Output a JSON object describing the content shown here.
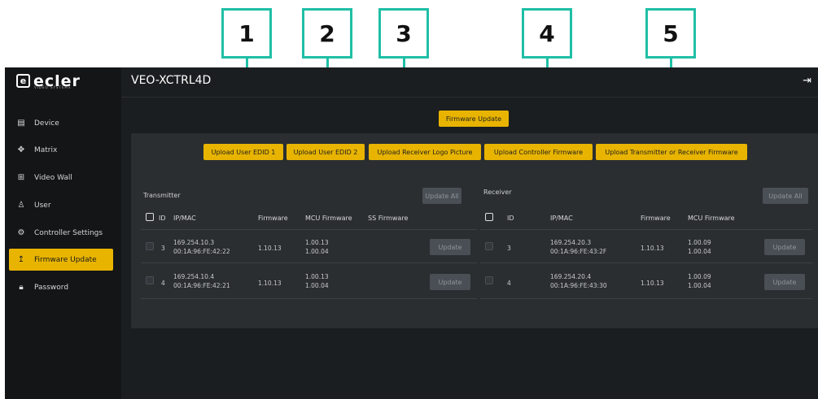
{
  "callouts": [
    "1",
    "2",
    "3",
    "4",
    "5"
  ],
  "brand": {
    "name": "ecler",
    "sub": "VIDEO SYSTEMS"
  },
  "sidebar": {
    "items": [
      {
        "label": "Device",
        "icon": "device-icon"
      },
      {
        "label": "Matrix",
        "icon": "matrix-icon"
      },
      {
        "label": "Video Wall",
        "icon": "grid-icon"
      },
      {
        "label": "User",
        "icon": "user-icon"
      },
      {
        "label": "Controller Settings",
        "icon": "gear-icon"
      },
      {
        "label": "Firmware Update",
        "icon": "upload-icon",
        "active": true
      },
      {
        "label": "Password",
        "icon": "lock-icon"
      }
    ]
  },
  "header": {
    "title": "VEO-XCTRL4D"
  },
  "main": {
    "firmware_update_button": "Firmware Update",
    "upload_buttons": [
      "Upload User EDID 1",
      "Upload User EDID 2",
      "Upload Receiver Logo Picture",
      "Upload Controller Firmware",
      "Upload Transmitter or Receiver Firmware"
    ],
    "transmitter": {
      "title": "Transmitter",
      "update_all": "Update All",
      "columns": [
        "ID",
        "IP/MAC",
        "Firmware",
        "MCU Firmware",
        "SS Firmware"
      ],
      "rows": [
        {
          "id": "3",
          "ip": "169.254.10.3",
          "mac": "00:1A:96:FE:42:22",
          "firmware": "1.10.13",
          "mcu1": "1.00.13",
          "mcu2": "1.00.04",
          "update": "Update"
        },
        {
          "id": "4",
          "ip": "169.254.10.4",
          "mac": "00:1A:96:FE:42:21",
          "firmware": "1.10.13",
          "mcu1": "1.00.13",
          "mcu2": "1.00.04",
          "update": "Update"
        }
      ]
    },
    "receiver": {
      "title": "Receiver",
      "update_all": "Update All",
      "columns": [
        "ID",
        "IP/MAC",
        "Firmware",
        "MCU Firmware"
      ],
      "rows": [
        {
          "id": "3",
          "ip": "169.254.20.3",
          "mac": "00:1A:96:FE:43:2F",
          "firmware": "1.10.13",
          "mcu1": "1.00.09",
          "mcu2": "1.00.04",
          "update": "Update"
        },
        {
          "id": "4",
          "ip": "169.254.20.4",
          "mac": "00:1A:96:FE:43:30",
          "firmware": "1.10.13",
          "mcu1": "1.00.09",
          "mcu2": "1.00.04",
          "update": "Update"
        }
      ]
    }
  },
  "colors": {
    "accent": "#e8b400",
    "callout": "#1fbfa6",
    "background": "#1b1e20",
    "sidebar": "#131517"
  }
}
